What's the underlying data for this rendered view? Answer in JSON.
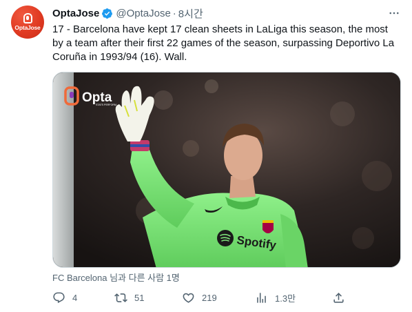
{
  "tweet": {
    "author": {
      "display_name": "OptaJose",
      "handle": "@OptaJose",
      "avatar_text": "OptaJose",
      "verified": true
    },
    "time": "8시간",
    "separator": "·",
    "text": "17 - Barcelona have kept 17 clean sheets in LaLiga this season, the most by a team after their first 22 games of the season, surpassing Deportivo La Coruña in 1993/94 (16). Wall.",
    "media": {
      "overlay_logo": "Opta",
      "overlay_sub": "STATS PERFORM",
      "shirt_sponsor": "Spotify"
    },
    "tagged": "FC Barcelona 님과 다른 사람 1명",
    "actions": {
      "reply": {
        "icon": "reply-icon",
        "count": "4"
      },
      "retweet": {
        "icon": "retweet-icon",
        "count": "51"
      },
      "like": {
        "icon": "heart-icon",
        "count": "219"
      },
      "views": {
        "icon": "analytics-icon",
        "count": "1.3만"
      },
      "share": {
        "icon": "share-icon"
      }
    }
  },
  "colors": {
    "avatar": "#e03a22",
    "verified": "#1d9bf0",
    "secondary_text": "#536471",
    "jersey": "#7ee07a"
  }
}
